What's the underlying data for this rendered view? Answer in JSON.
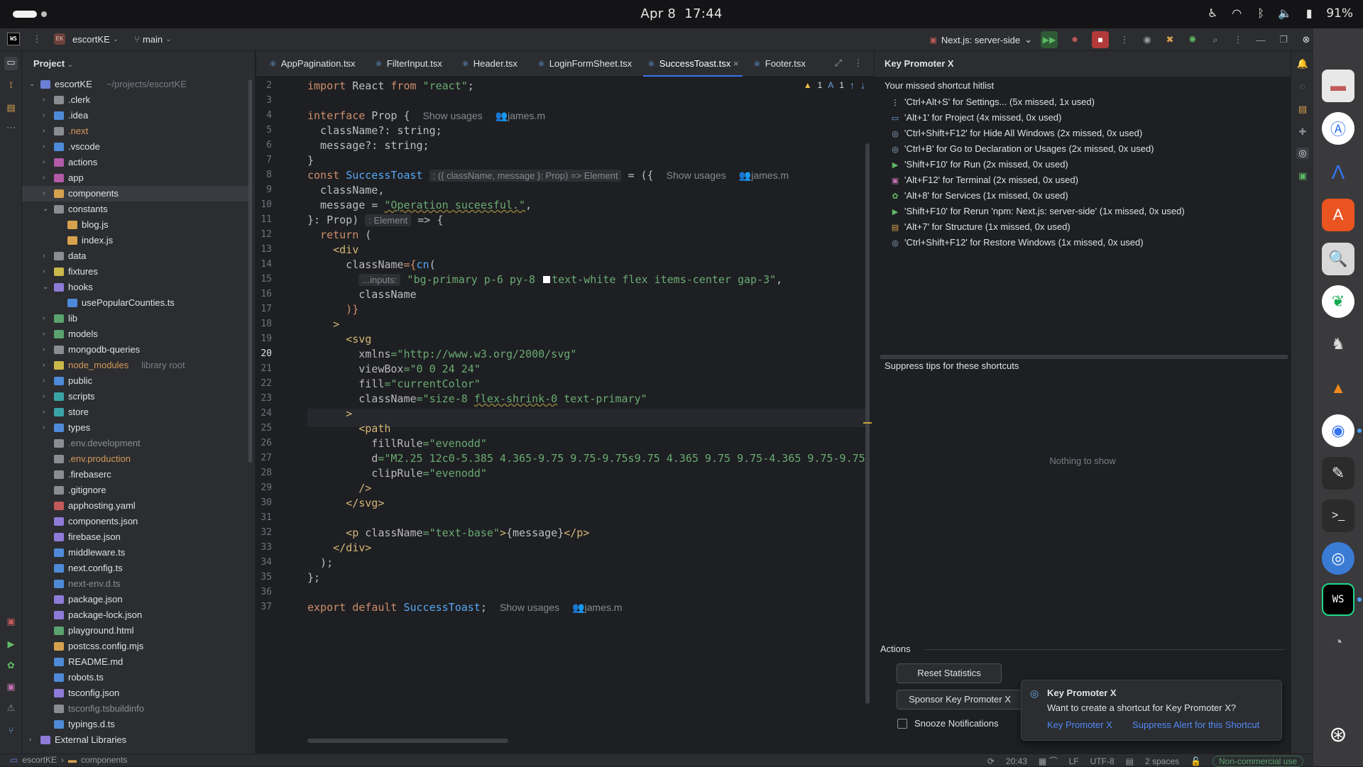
{
  "system": {
    "date": "Apr 8",
    "time": "17:44",
    "battery": "91%"
  },
  "titlebar": {
    "project_badge": "EK",
    "project": "escortKE",
    "branch": "main",
    "run_config": "Next.js: server-side"
  },
  "project_panel": {
    "title": "Project"
  },
  "tree": [
    {
      "label": "escortKE",
      "extra": "~/projects/escortKE",
      "level": 0,
      "arrow": "open",
      "color": "#6b7fd6"
    },
    {
      "label": ".clerk",
      "level": 1,
      "arrow": "closed",
      "color": "#8a8d93"
    },
    {
      "label": ".idea",
      "level": 1,
      "arrow": "closed",
      "color": "#4e8ad8"
    },
    {
      "label": ".next",
      "level": 1,
      "arrow": "closed",
      "color": "#8a8d93",
      "style": "orange"
    },
    {
      "label": ".vscode",
      "level": 1,
      "arrow": "closed",
      "color": "#4e8ad8"
    },
    {
      "label": "actions",
      "level": 1,
      "arrow": "closed",
      "color": "#b25aa6"
    },
    {
      "label": "app",
      "level": 1,
      "arrow": "closed",
      "color": "#b25aa6"
    },
    {
      "label": "components",
      "level": 1,
      "arrow": "closed",
      "color": "#d6a14e",
      "selected": true
    },
    {
      "label": "constants",
      "level": 1,
      "arrow": "open",
      "color": "#8a8d93"
    },
    {
      "label": "blog.js",
      "level": 2,
      "color": "#d6a14e"
    },
    {
      "label": "index.js",
      "level": 2,
      "color": "#d6a14e"
    },
    {
      "label": "data",
      "level": 1,
      "arrow": "closed",
      "color": "#8a8d93"
    },
    {
      "label": "fixtures",
      "level": 1,
      "arrow": "closed",
      "color": "#c9b84a"
    },
    {
      "label": "hooks",
      "level": 1,
      "arrow": "open",
      "color": "#8e7bd8"
    },
    {
      "label": "usePopularCounties.ts",
      "level": 2,
      "color": "#4e8ad8"
    },
    {
      "label": "lib",
      "level": 1,
      "arrow": "closed",
      "color": "#5aa36e"
    },
    {
      "label": "models",
      "level": 1,
      "arrow": "closed",
      "color": "#5aa36e"
    },
    {
      "label": "mongodb-queries",
      "level": 1,
      "arrow": "closed",
      "color": "#8a8d93"
    },
    {
      "label": "node_modules",
      "extra": "library root",
      "level": 1,
      "arrow": "closed",
      "color": "#c9b84a",
      "style": "orange"
    },
    {
      "label": "public",
      "level": 1,
      "arrow": "closed",
      "color": "#4e8ad8"
    },
    {
      "label": "scripts",
      "level": 1,
      "arrow": "closed",
      "color": "#3aa3a6"
    },
    {
      "label": "store",
      "level": 1,
      "arrow": "closed",
      "color": "#3aa3a6"
    },
    {
      "label": "types",
      "level": 1,
      "arrow": "closed",
      "color": "#4e8ad8"
    },
    {
      "label": ".env.development",
      "level": 1,
      "color": "#8a8d93",
      "style": "gray"
    },
    {
      "label": ".env.production",
      "level": 1,
      "color": "#8a8d93",
      "style": "orange"
    },
    {
      "label": ".firebaserc",
      "level": 1,
      "color": "#8a8d93"
    },
    {
      "label": ".gitignore",
      "level": 1,
      "color": "#8a8d93"
    },
    {
      "label": "apphosting.yaml",
      "level": 1,
      "color": "#c25a5a"
    },
    {
      "label": "components.json",
      "level": 1,
      "color": "#8e7bd8"
    },
    {
      "label": "firebase.json",
      "level": 1,
      "color": "#8e7bd8"
    },
    {
      "label": "middleware.ts",
      "level": 1,
      "color": "#4e8ad8"
    },
    {
      "label": "next.config.ts",
      "level": 1,
      "color": "#4e8ad8"
    },
    {
      "label": "next-env.d.ts",
      "level": 1,
      "color": "#4e8ad8",
      "style": "gray"
    },
    {
      "label": "package.json",
      "level": 1,
      "color": "#8e7bd8"
    },
    {
      "label": "package-lock.json",
      "level": 1,
      "color": "#8e7bd8"
    },
    {
      "label": "playground.html",
      "level": 1,
      "color": "#5aa36e"
    },
    {
      "label": "postcss.config.mjs",
      "level": 1,
      "color": "#d6a14e"
    },
    {
      "label": "README.md",
      "level": 1,
      "color": "#4e8ad8"
    },
    {
      "label": "robots.ts",
      "level": 1,
      "color": "#4e8ad8"
    },
    {
      "label": "tsconfig.json",
      "level": 1,
      "color": "#8e7bd8"
    },
    {
      "label": "tsconfig.tsbuildinfo",
      "level": 1,
      "color": "#8a8d93",
      "style": "gray"
    },
    {
      "label": "typings.d.ts",
      "level": 1,
      "color": "#4e8ad8"
    },
    {
      "label": "External Libraries",
      "level": 0,
      "arrow": "closed",
      "color": "#8e7bd8"
    }
  ],
  "tabs": [
    {
      "label": "AppPagination.tsx"
    },
    {
      "label": "FilterInput.tsx"
    },
    {
      "label": "Header.tsx"
    },
    {
      "label": "LoginFormSheet.tsx"
    },
    {
      "label": "SuccessToast.tsx",
      "active": true
    },
    {
      "label": "Footer.tsx"
    }
  ],
  "inspections": {
    "warnings": "1",
    "weak": "1"
  },
  "editor": {
    "current_line": 20,
    "line_numbers": [
      "2",
      "3",
      "4",
      "5",
      "6",
      "7",
      "8",
      "9",
      "10",
      "11",
      "12",
      "13",
      "14",
      "15",
      "16",
      "17",
      "18",
      "19",
      "20",
      "21",
      "22",
      "23",
      "24",
      "25",
      "26",
      "27",
      "28",
      "29",
      "30",
      "31",
      "32",
      "33",
      "34",
      "35",
      "36",
      "37"
    ],
    "l2": {
      "kw1": "import",
      "name": " React ",
      "kw2": "from",
      "str": " \"react\"",
      "end": ";"
    },
    "l4": {
      "kw": "interface",
      "name": " Prop {",
      "usage": "Show usages",
      "author": "james.m"
    },
    "l5": "  className?: string;",
    "l6": "  message?: string;",
    "l7": "}",
    "l8": {
      "kw": "const",
      "name": "SuccessToast",
      "hint": ": ({ className, message }: Prop) => Element",
      "rest": " = ({",
      "usage": "Show usages",
      "author": "james.m"
    },
    "l9": "  className,",
    "l10": {
      "pre": "  message = ",
      "str": "\"Operation suceesful.\"",
      "end": ","
    },
    "l11": {
      "pre": "}: Prop)",
      "hint": ": Element",
      "rest": " => {"
    },
    "l12": {
      "kw": "  return",
      "rest": " ("
    },
    "l13": "    <div",
    "l14": {
      "attr": "      className",
      "rest": "={",
      "fn": "cn",
      "end": "("
    },
    "l15": {
      "hint": "...inputs:",
      "str1": " \"bg-primary p-6 py-8 ",
      "str2": "text-white flex items-center gap-3\"",
      "end": ","
    },
    "l16": "        className",
    "l17": "      )}",
    "l18": "    >",
    "l19": "      <svg",
    "l20": {
      "attr": "        xmlns",
      "str": "=\"http://www.w3.org/2000/svg\""
    },
    "l21": {
      "attr": "        viewBox",
      "str": "=\"0 0 24 24\""
    },
    "l22": {
      "attr": "        fill",
      "str": "=\"currentColor\""
    },
    "l23": {
      "attr": "        className",
      "str1": "=\"size-8 ",
      "sq": "flex-shrink-0",
      "str2": " text-primary\""
    },
    "l24": "      >",
    "l25": "        <path",
    "l26": {
      "attr": "          fillRule",
      "str": "=\"evenodd\""
    },
    "l27": {
      "attr": "          d",
      "str": "=\"M2.25 12c0-5.385 4.365-9.75 9.75-9.75s9.75 4.365 9.75 9.75-4.365 9.75-9.75 9"
    },
    "l28": {
      "attr": "          clipRule",
      "str": "=\"evenodd\""
    },
    "l29": "        />",
    "l30": "      </svg>",
    "l31": "",
    "l32": {
      "tag1": "      <p ",
      "attr": "className",
      "str": "=\"text-base\"",
      "tag2": ">",
      "expr": "{message}",
      "tag3": "</p>"
    },
    "l33": "    </div>",
    "l34": "  );",
    "l35": "};",
    "l36": "",
    "l37": {
      "kw": "export default",
      "name": " SuccessToast",
      "end": ";",
      "usage": "Show usages",
      "author": "james.m"
    }
  },
  "kpx": {
    "title": "Key Promoter X",
    "hitlist_title": "Your missed shortcut hitlist",
    "hits": [
      {
        "icon": "⋮",
        "color": "#dfe1e5",
        "text": "'Ctrl+Alt+S' for Settings... (5x missed, 1x used)"
      },
      {
        "icon": "▭",
        "color": "#6ca7e8",
        "text": "'Alt+1' for Project (4x missed, 0x used)"
      },
      {
        "icon": "◎",
        "color": "#9ab6d8",
        "text": "'Ctrl+Shift+F12' for Hide All Windows (2x missed, 0x used)"
      },
      {
        "icon": "◎",
        "color": "#9ab6d8",
        "text": "'Ctrl+B' for Go to Declaration or Usages (2x missed, 0x used)"
      },
      {
        "icon": "▶",
        "color": "#5fb865",
        "text": "'Shift+F10' for Run (2x missed, 0x used)"
      },
      {
        "icon": "▣",
        "color": "#c070b0",
        "text": "'Alt+F12' for Terminal (2x missed, 0x used)"
      },
      {
        "icon": "✿",
        "color": "#5fb865",
        "text": "'Alt+8' for Services (1x missed, 0x used)"
      },
      {
        "icon": "▶",
        "color": "#5fb865",
        "text": "'Shift+F10' for Rerun 'npm: Next.js: server-side' (1x missed, 0x used)"
      },
      {
        "icon": "▤",
        "color": "#d6a14e",
        "text": "'Alt+7' for Structure (1x missed, 0x used)"
      },
      {
        "icon": "◎",
        "color": "#9ab6d8",
        "text": "'Ctrl+Shift+F12' for Restore Windows (1x missed, 0x used)"
      }
    ],
    "suppress_title": "Suppress tips for these shortcuts",
    "empty": "Nothing to show",
    "actions_title": "Actions",
    "reset": "Reset Statistics",
    "sponsor": "Sponsor Key Promoter X",
    "snooze": "Snooze Notifications"
  },
  "notification": {
    "title": "Key Promoter X",
    "body": "Want to create a shortcut for Key Promoter X?",
    "link1": "Key Promoter X",
    "link2": "Suppress Alert for this Shortcut"
  },
  "status": {
    "path1": "escortKE",
    "path2": "components",
    "position": "20:43",
    "line_sep": "LF",
    "encoding": "UTF-8",
    "indent": "2 spaces",
    "license": "Non-commercial use"
  }
}
